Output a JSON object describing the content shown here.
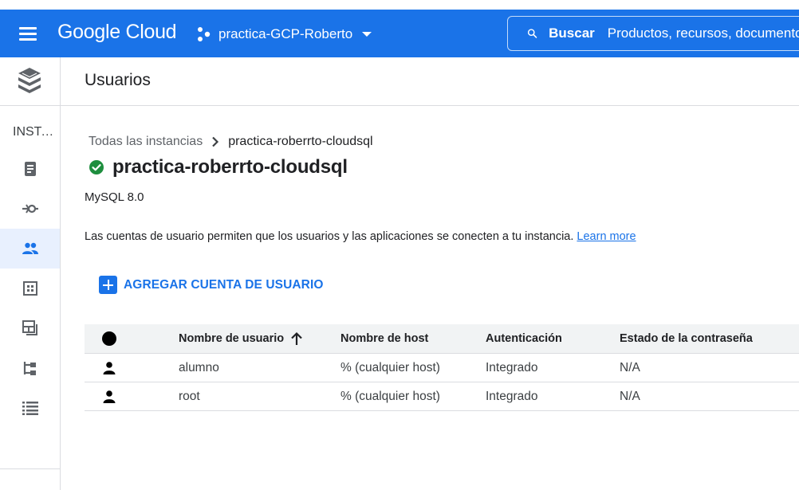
{
  "app": {
    "brand": "Google Cloud",
    "project": "practica-GCP-Roberto",
    "search_label": "Buscar",
    "search_placeholder": "Productos, recursos, documentos"
  },
  "sidenav": {
    "title": "INSTANCIAS",
    "items": [
      {
        "icon": "overview-icon",
        "active": false
      },
      {
        "icon": "connections-icon",
        "active": false
      },
      {
        "icon": "users-icon",
        "active": true
      },
      {
        "icon": "databases-icon",
        "active": false
      },
      {
        "icon": "backups-icon",
        "active": false
      },
      {
        "icon": "replicas-icon",
        "active": false
      },
      {
        "icon": "operations-icon",
        "active": false
      }
    ]
  },
  "page": {
    "title": "Usuarios"
  },
  "breadcrumb": {
    "parent": "Todas las instancias",
    "current": "practica-roberrto-cloudsql"
  },
  "instance": {
    "name": "practica-roberrto-cloudsql",
    "version": "MySQL 8.0",
    "status_color": "#1e8e3e"
  },
  "description": {
    "text": "Las cuentas de usuario permiten que los usuarios y las aplicaciones se conecten a tu instancia.",
    "link": "Learn more"
  },
  "actions": {
    "add_user": "AGREGAR CUENTA DE USUARIO"
  },
  "table": {
    "headers": {
      "user": "Nombre de usuario",
      "host": "Nombre de host",
      "auth": "Autenticación",
      "password_state": "Estado de la contraseña"
    },
    "rows": [
      {
        "user": "alumno",
        "host": "% (cualquier host)",
        "auth": "Integrado",
        "password_state": "N/A"
      },
      {
        "user": "root",
        "host": "% (cualquier host)",
        "auth": "Integrado",
        "password_state": "N/A"
      }
    ]
  },
  "colors": {
    "topbar": "#1a73e8",
    "accent": "#1a73e8",
    "active_nav": "#e8f0fe"
  }
}
